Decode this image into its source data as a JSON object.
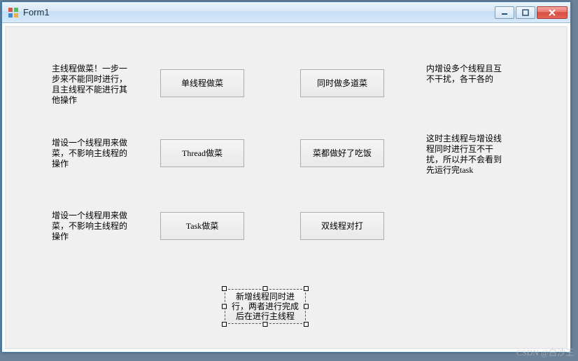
{
  "window": {
    "title": "Form1"
  },
  "rows": [
    {
      "left_label": "主线程做菜！一步一步来不能同时进行，且主线程不能进行其他操作",
      "btn1": "单线程做菜",
      "btn2": "同时做多道菜",
      "right_label": "内增设多个线程且互不干扰，各干各的"
    },
    {
      "left_label": "增设一个线程用来做菜，不影响主线程的操作",
      "btn1": "Thread做菜",
      "btn2": "菜都做好了吃饭",
      "right_label": "这时主线程与增设线程同时进行互不干扰，所以并不会看到先运行完task"
    },
    {
      "left_label": "增设一个线程用来做菜，不影响主线程的操作",
      "btn1": "Task做菜",
      "btn2": "双线程对打",
      "right_label": ""
    }
  ],
  "selected_button": "新增线程同时进行，两者进行完成后在进行主线程",
  "watermark": "CSDN @白沙王"
}
